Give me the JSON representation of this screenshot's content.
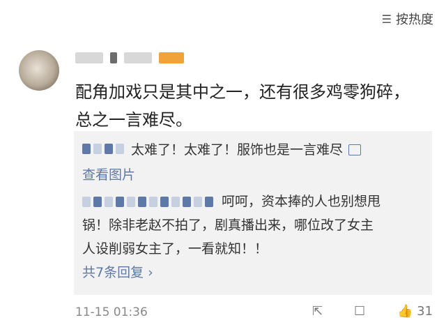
{
  "sort": {
    "label": "按热度",
    "icon": "sort-icon"
  },
  "comment": {
    "text_line1": "配角加戏只是其中之一，还有很多鸡零狗碎，",
    "text_line2": "总之一言难尽。",
    "time": "11-15 01:36",
    "likes": "31"
  },
  "replies": {
    "r1": {
      "text": "太难了！太难了！服饰也是一言难尽"
    },
    "view_image": "查看图片",
    "r2": {
      "line1": "呵呵，资本捧的人也别想甩",
      "line2": "锅！除非老赵不拍了，剧真播出来，哪位改了女主",
      "line3": "人设削弱女主了，一看就知！！"
    },
    "total": "共7条回复 ›"
  },
  "colors": {
    "link": "#5e79a8",
    "reply_bg": "#f2f2f2"
  }
}
